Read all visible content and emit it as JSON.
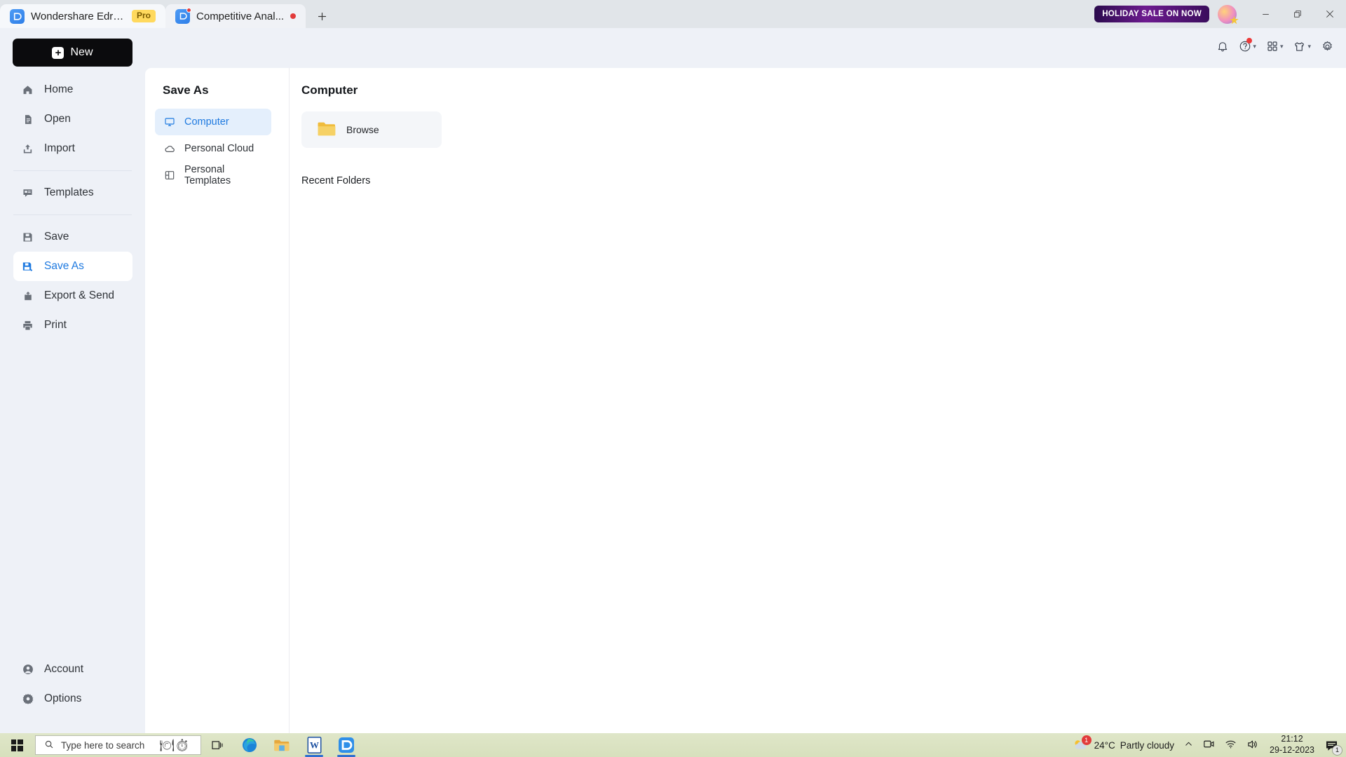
{
  "titlebar": {
    "tabs": [
      {
        "label": "Wondershare EdrawMax",
        "badge": "Pro",
        "active": true
      },
      {
        "label": "Competitive Anal...",
        "badge": "",
        "active": false
      }
    ],
    "new_tab_icon": "plus-icon",
    "promo_label": "HOLIDAY SALE ON NOW",
    "minimize_label": "—",
    "restore_label": "❐",
    "close_label": "✕"
  },
  "iconbar": {
    "items": [
      {
        "name": "notification-bell-icon",
        "caret": false,
        "dot": false
      },
      {
        "name": "help-icon",
        "caret": true,
        "dot": true
      },
      {
        "name": "apps-grid-icon",
        "caret": true,
        "dot": false
      },
      {
        "name": "theme-shirt-icon",
        "caret": true,
        "dot": false
      },
      {
        "name": "settings-gear-icon",
        "caret": false,
        "dot": false
      }
    ]
  },
  "sidebar": {
    "new_button": "New",
    "items": [
      {
        "label": "Home",
        "icon": "home-icon",
        "active": false
      },
      {
        "label": "Open",
        "icon": "document-icon",
        "active": false
      },
      {
        "label": "Import",
        "icon": "import-icon",
        "active": false
      },
      {
        "label": "Templates",
        "icon": "templates-icon",
        "active": false
      },
      {
        "label": "Save",
        "icon": "save-icon",
        "active": false
      },
      {
        "label": "Save As",
        "icon": "save-as-icon",
        "active": true
      },
      {
        "label": "Export & Send",
        "icon": "export-icon",
        "active": false
      },
      {
        "label": "Print",
        "icon": "printer-icon",
        "active": false
      }
    ],
    "bottom_items": [
      {
        "label": "Account",
        "icon": "account-icon"
      },
      {
        "label": "Options",
        "icon": "options-gear-icon"
      }
    ]
  },
  "saveas_panel": {
    "title": "Save As",
    "items": [
      {
        "label": "Computer",
        "icon": "monitor-icon",
        "active": true
      },
      {
        "label": "Personal Cloud",
        "icon": "cloud-icon",
        "active": false
      },
      {
        "label": "Personal Templates",
        "icon": "layout-icon",
        "active": false
      }
    ]
  },
  "content_panel": {
    "title": "Computer",
    "browse_label": "Browse",
    "browse_icon": "folder-icon",
    "recent_folders_label": "Recent Folders",
    "recent_folders": []
  },
  "taskbar": {
    "start_icon": "windows-start-icon",
    "search_placeholder": "Type here to search",
    "search_icon": "search-icon",
    "doodle_icon": "bing-doodle-icon",
    "pinned": [
      {
        "name": "task-view-icon",
        "running": false
      },
      {
        "name": "microsoft-edge-icon",
        "running": false
      },
      {
        "name": "file-explorer-icon",
        "running": false
      },
      {
        "name": "microsoft-word-icon",
        "running": true
      },
      {
        "name": "edrawmax-icon",
        "running": true
      }
    ],
    "tray": {
      "weather_temp": "24°C",
      "weather_desc": "Partly cloudy",
      "weather_badge": "1",
      "chevron_icon": "show-hidden-icons-icon",
      "meet_now_icon": "meet-now-icon",
      "network_icon": "wifi-icon",
      "volume_icon": "speaker-icon",
      "time": "21:12",
      "date": "29-12-2023",
      "action_center_icon": "action-center-icon",
      "action_center_badge": "1"
    }
  },
  "colors": {
    "accent": "#1f7ae0",
    "window_bg": "#eef1f7",
    "card_bg": "#ffffff",
    "titlebar_bg": "#e1e5e9",
    "new_button_bg": "#0b0b0d",
    "folder": "#f2c43d",
    "badge_red": "#e23b3b"
  }
}
